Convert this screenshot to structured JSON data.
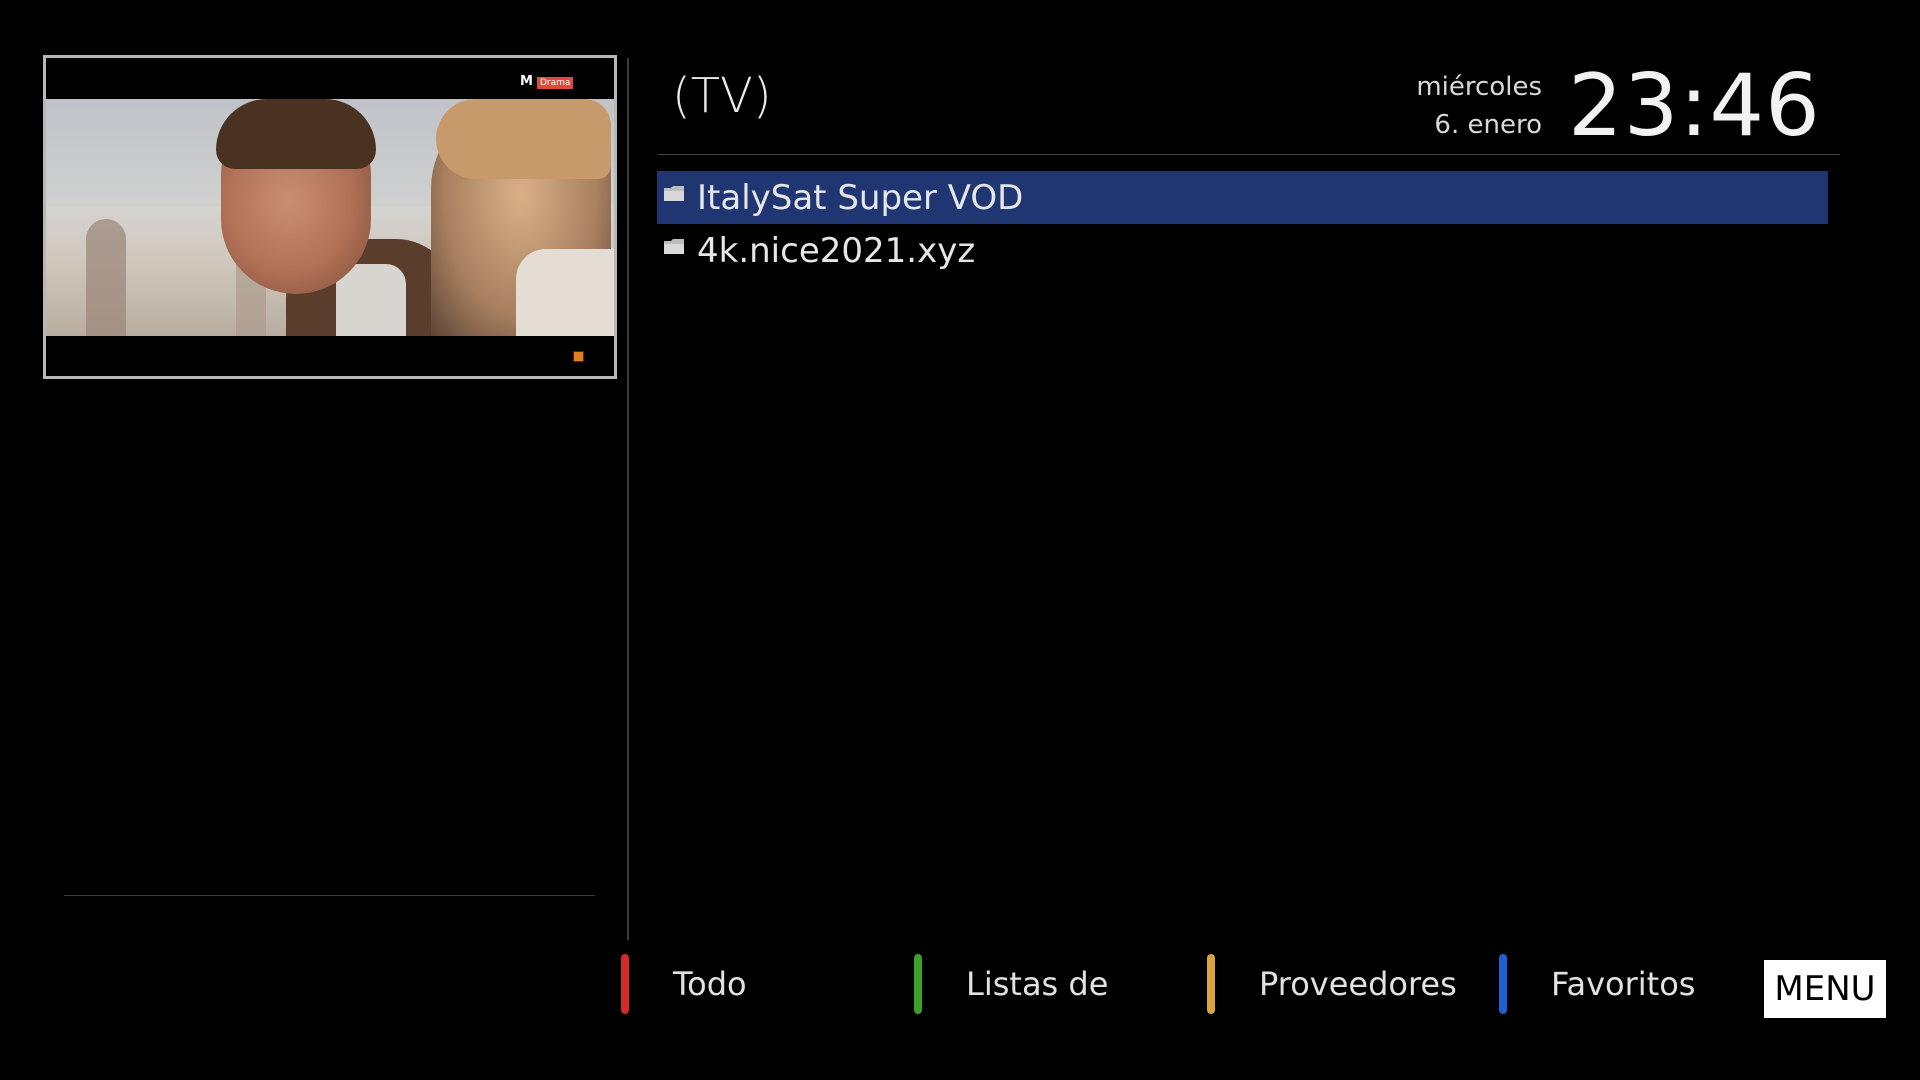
{
  "header": {
    "title": "(TV)",
    "date_line1": "miércoles",
    "date_line2": "6. enero",
    "time": "23:46"
  },
  "preview": {
    "channel_logo": "M",
    "channel_badge": "Drama"
  },
  "list": {
    "items": [
      {
        "label": "ItalySat Super VOD",
        "icon": "folder-icon",
        "selected": true
      },
      {
        "label": "4k.nice2021.xyz",
        "icon": "folder-icon",
        "selected": false
      }
    ],
    "selection_color": "#1f3672"
  },
  "footer": {
    "buttons": [
      {
        "label": "Todo",
        "color": "#d42a2a"
      },
      {
        "label": "Listas de",
        "color": "#3aa02a"
      },
      {
        "label": "Proveedores",
        "color": "#d9a43a"
      },
      {
        "label": "Favoritos",
        "color": "#1f5fd0"
      }
    ],
    "menu_label": "MENU"
  }
}
